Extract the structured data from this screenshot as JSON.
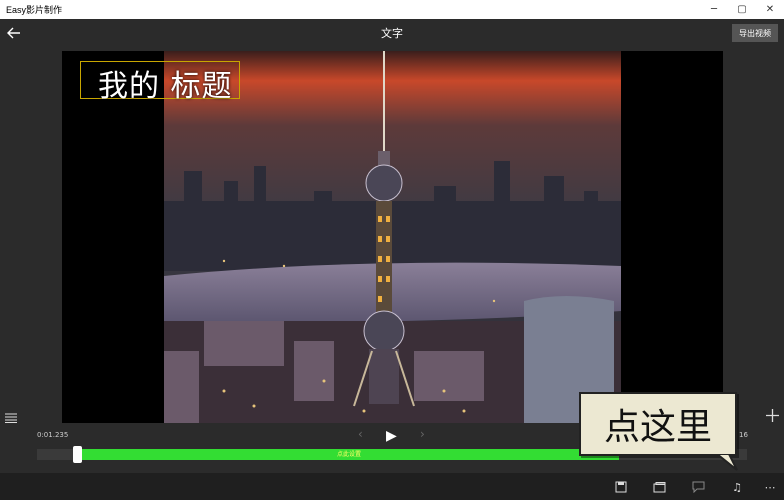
{
  "window": {
    "title": "Easy影片制作",
    "min": "─",
    "max": "▢",
    "close": "✕"
  },
  "header": {
    "title": "文字",
    "export_label": "导出视频"
  },
  "preview": {
    "caption": "我的 标题"
  },
  "player": {
    "time_current": "0:01.235",
    "time_end": "16",
    "track_label": "点此设置",
    "progress": 0.056
  },
  "callout": {
    "text": "点这里"
  },
  "colors": {
    "accent": "#33dd33",
    "caption_border": "#c8a600",
    "background": "#2b2b2b"
  }
}
